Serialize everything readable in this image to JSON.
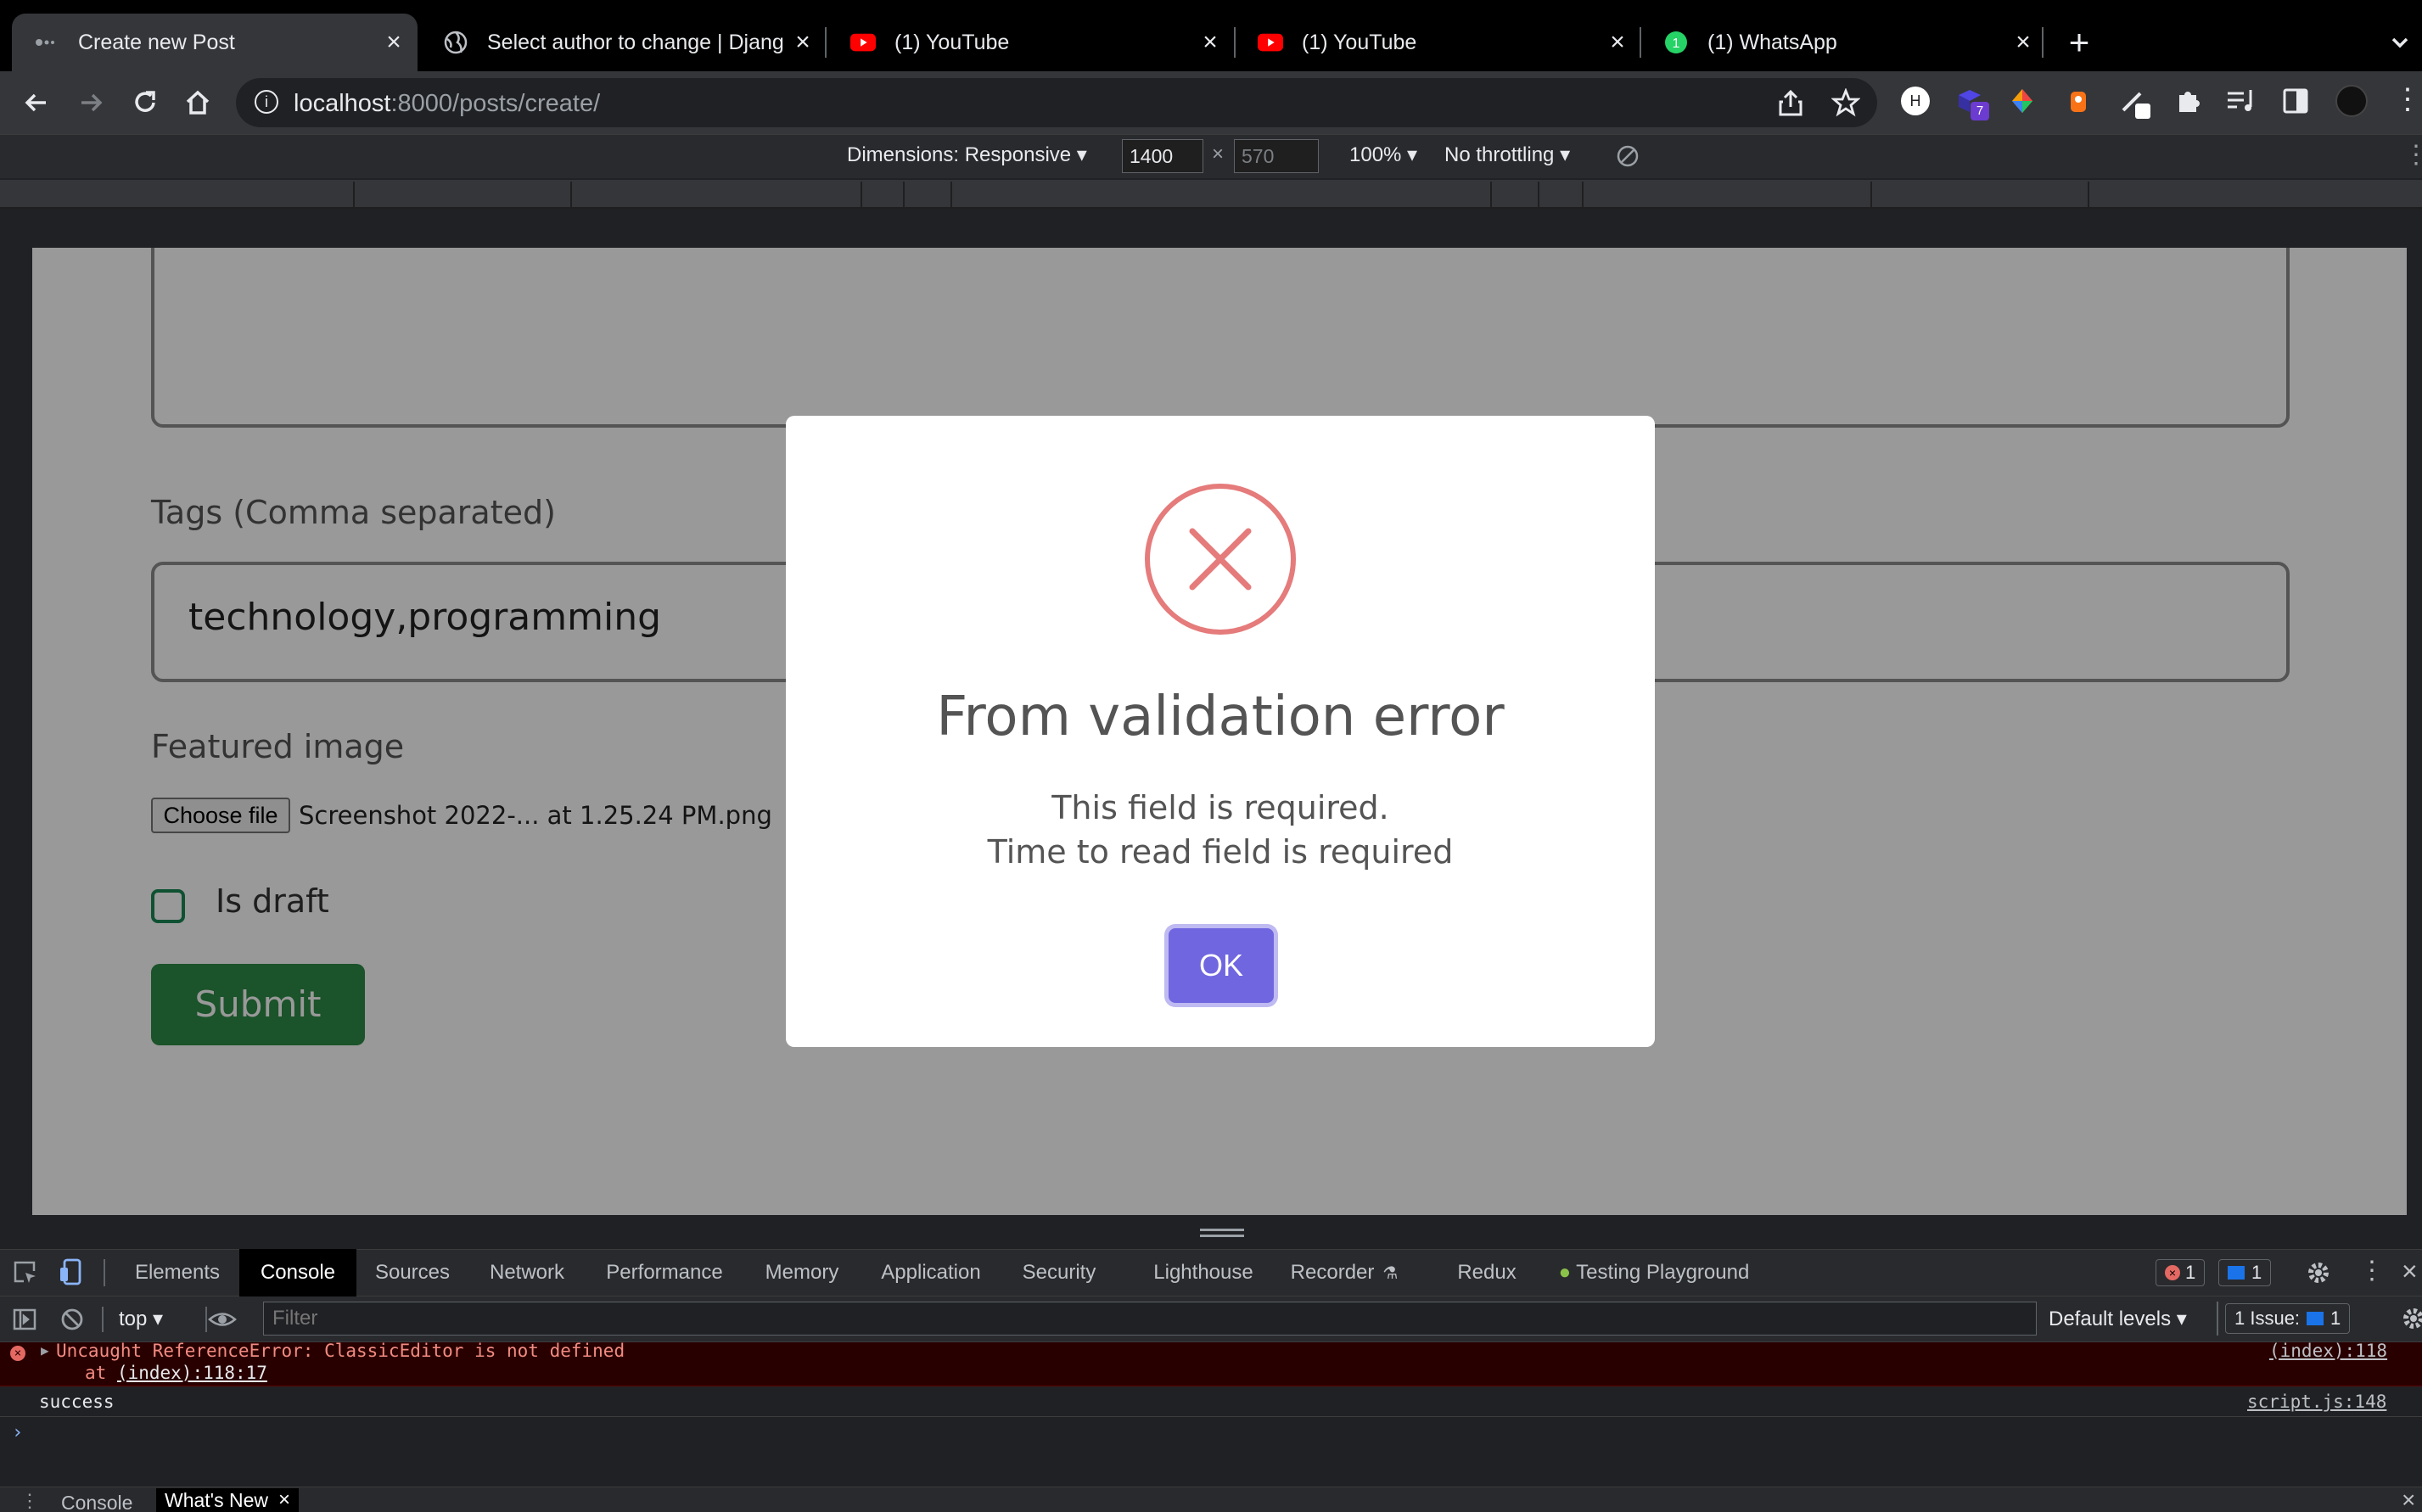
{
  "tabs": [
    {
      "title": "Create new Post",
      "icon": "django-icon",
      "active": true
    },
    {
      "title": "Select author to change | Djang",
      "icon": "globe-icon",
      "active": false
    },
    {
      "title": "(1) YouTube",
      "icon": "youtube-icon",
      "active": false
    },
    {
      "title": "(1) YouTube",
      "icon": "youtube-icon",
      "active": false
    },
    {
      "title": "(1) WhatsApp",
      "icon": "whatsapp-icon",
      "active": false
    }
  ],
  "address": {
    "host": "localhost",
    "rest": ":8000/posts/create/"
  },
  "device_toolbar": {
    "dimensions": "Dimensions: Responsive",
    "width": "1400",
    "height": "570",
    "zoom": "100%",
    "throttling": "No throttling"
  },
  "extensions_badge": "7",
  "form": {
    "tags_label": "Tags (Comma separated)",
    "tags_value": "technology,programming",
    "image_label": "Featured image",
    "choose_file": "Choose file",
    "file_name": "Screenshot 2022-... at 1.25.24 PM.png",
    "draft_label": "Is draft",
    "submit": "Submit"
  },
  "modal": {
    "title": "From validation error",
    "line1": "This field is required.",
    "line2": "Time to read field is required",
    "ok": "OK"
  },
  "devtools": {
    "tabs": [
      "Elements",
      "Console",
      "Sources",
      "Network",
      "Performance",
      "Memory",
      "Application",
      "Security",
      "Lighthouse",
      "Recorder",
      "Redux",
      "Testing Playground"
    ],
    "active_tab": "Console",
    "error_count": "1",
    "message_count": "1",
    "context": "top",
    "filter_placeholder": "Filter",
    "levels": "Default levels",
    "issues": "1 Issue:",
    "issues_count": "1",
    "error_message": "Uncaught ReferenceError: ClassicEditor is not defined",
    "error_at_prefix": "at ",
    "error_at_link": "(index):118:17",
    "error_source": "(index):118",
    "log_message": "success",
    "log_source": "script.js:148",
    "drawer_tabs": [
      "Console",
      "What's New"
    ]
  },
  "colors": {
    "accent": "#7066e0",
    "error_icon": "#e57b7b",
    "submit_bg": "#2e8b47"
  }
}
